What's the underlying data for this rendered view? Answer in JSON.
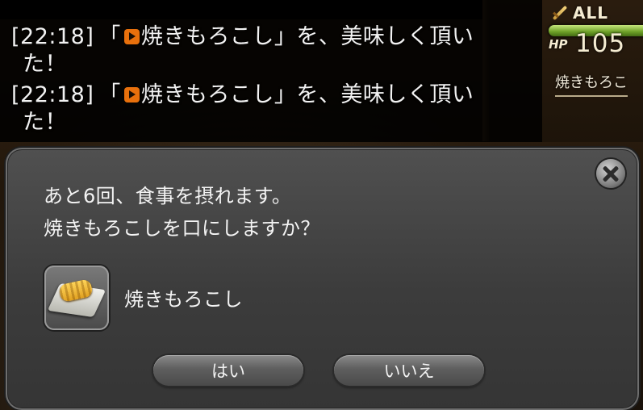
{
  "chat": {
    "lines": [
      {
        "time": "[22:18]",
        "open_bracket": "「",
        "item": "焼きもろこし",
        "rest_line1": "」を、美味しく頂い",
        "rest_line2": "た！"
      },
      {
        "time": "[22:18]",
        "open_bracket": "「",
        "item": "焼きもろこし",
        "rest_line1": "」を、美味しく頂い",
        "rest_line2": "た！"
      }
    ],
    "item_link_icon": "item-link-arrow-icon",
    "item_link_color": "#e8700c"
  },
  "party": {
    "target_label": "ALL",
    "target_icon": "sword-icon",
    "hp_label": "HP",
    "hp_value": "105",
    "status_item": "焼きもろこ",
    "hp_bar_color": "#8fc23f"
  },
  "dialog": {
    "message_line1": "あと6回、食事を摂れます。",
    "message_line2": "焼きもろこしを口にしますか？",
    "item_icon": "grilled-corn-icon",
    "item_name": "焼きもろこし",
    "yes_label": "はい",
    "no_label": "いいえ",
    "close_icon": "close-icon"
  }
}
